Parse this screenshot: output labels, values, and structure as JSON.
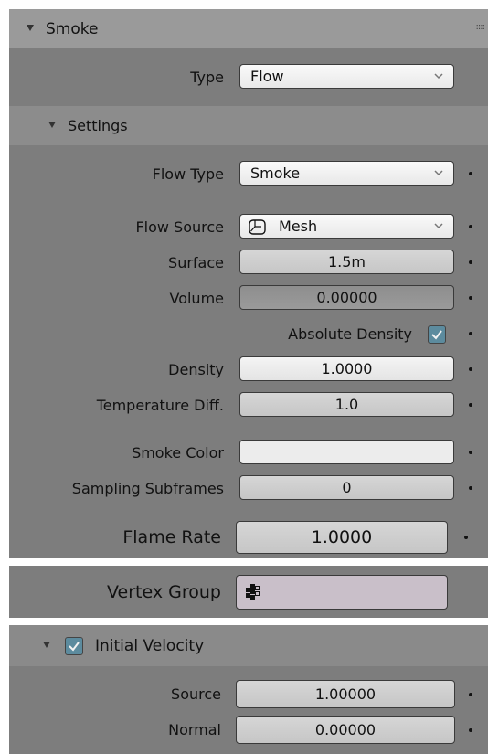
{
  "panel": {
    "title": "Smoke",
    "grip": "::::",
    "type": {
      "label": "Type",
      "value": "Flow"
    },
    "settings": {
      "title": "Settings",
      "flow_type": {
        "label": "Flow Type",
        "value": "Smoke"
      },
      "flow_source": {
        "label": "Flow Source",
        "value": "Mesh"
      },
      "surface": {
        "label": "Surface",
        "value": "1.5m"
      },
      "volume": {
        "label": "Volume",
        "value": "0.00000"
      },
      "absolute_density": {
        "label": "Absolute Density",
        "checked": true
      },
      "density": {
        "label": "Density",
        "value": "1.0000"
      },
      "temperature_diff": {
        "label": "Temperature Diff.",
        "value": "1.0"
      },
      "smoke_color": {
        "label": "Smoke Color",
        "value": ""
      },
      "sampling_subframes": {
        "label": "Sampling Subframes",
        "value": "0"
      },
      "flame_rate": {
        "label": "Flame Rate",
        "value": "1.0000"
      }
    }
  },
  "vertex_group": {
    "label": "Vertex Group",
    "value": ""
  },
  "initial_velocity": {
    "title": "Initial Velocity",
    "enabled": true,
    "source": {
      "label": "Source",
      "value": "1.00000"
    },
    "normal": {
      "label": "Normal",
      "value": "0.00000"
    }
  },
  "icons": {
    "collapse": "triangle-down-icon",
    "dropdown": "chevron-down-icon",
    "mesh": "mesh-cube-icon",
    "vertex_group": "vertex-group-icon",
    "checkbox": "checkmark-icon"
  },
  "colors": {
    "panel_bg": "#7d7d7d",
    "header_bg": "#9a9a9a",
    "checkbox_accent": "#5c8b9e",
    "vertex_field": "#c9bfc9"
  }
}
